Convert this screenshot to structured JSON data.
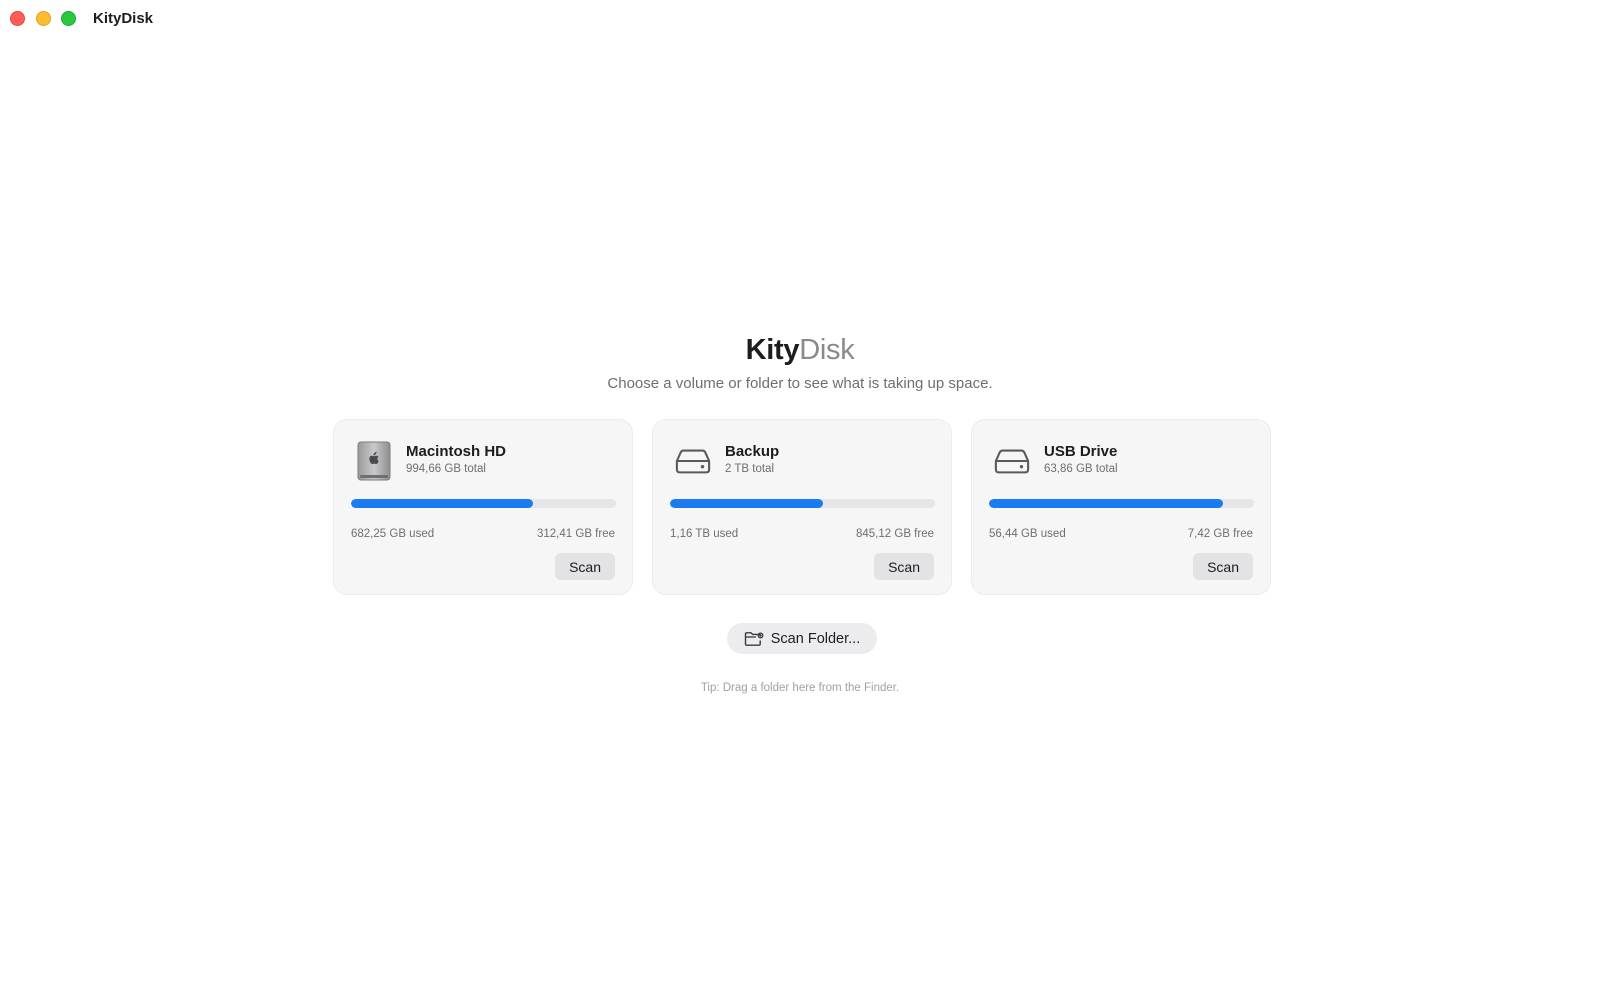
{
  "window": {
    "title": "KityDisk"
  },
  "hero": {
    "title_strong": "Kity",
    "title_light": "Disk",
    "subtitle": "Choose a volume or folder to see what is taking up space."
  },
  "volumes": [
    {
      "name": "Macintosh HD",
      "total": "994,66 GB total",
      "used": "682,25 GB used",
      "free": "312,41 GB free",
      "used_fraction": 0.686,
      "icon": "internal-disk-icon",
      "scan_label": "Scan"
    },
    {
      "name": "Backup",
      "total": "2 TB total",
      "used": "1,16 TB used",
      "free": "845,12 GB free",
      "used_fraction": 0.578,
      "icon": "external-drive-icon",
      "scan_label": "Scan"
    },
    {
      "name": "USB Drive",
      "total": "63,86 GB total",
      "used": "56,44 GB used",
      "free": "7,42 GB free",
      "used_fraction": 0.884,
      "icon": "external-drive-icon",
      "scan_label": "Scan"
    }
  ],
  "scan_folder": {
    "label": "Scan Folder...",
    "icon": "folder-badge-icon"
  },
  "tip": "Tip: Drag a folder here from the Finder.",
  "colors": {
    "accent": "#1a7cf0",
    "card_bg": "#f6f6f7",
    "bar_track": "#e6e6e8"
  }
}
